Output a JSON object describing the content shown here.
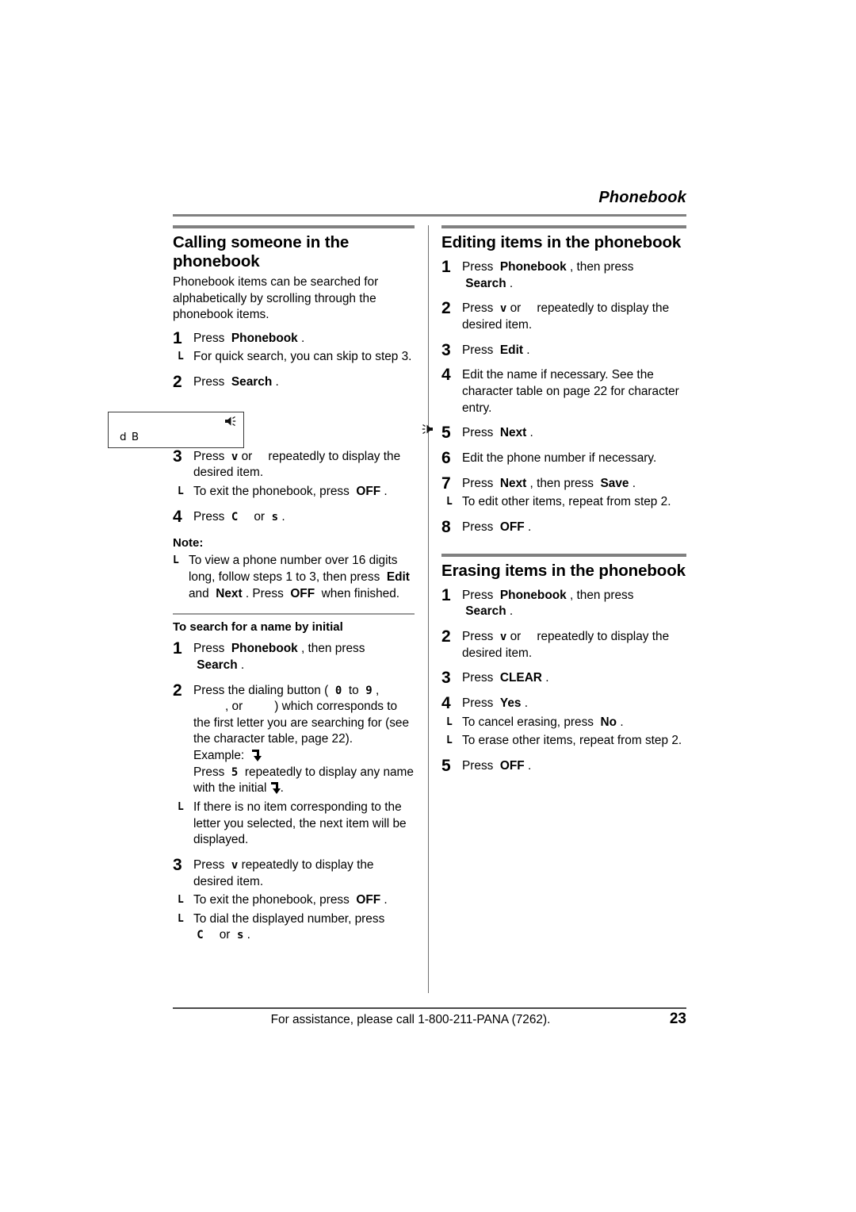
{
  "header": {
    "running_head": "Phonebook"
  },
  "left_column": {
    "section_title": "Calling someone in the phonebook",
    "intro": "Phonebook items can be searched for alphabetically by scrolling through the phonebook items.",
    "steps": [
      {
        "num": "1",
        "text_before": "Press",
        "key1": "Phonebook",
        "text_after": ".",
        "bullets": [
          "For quick search, you can skip to step 3."
        ]
      },
      {
        "num": "2",
        "text_before": "Press",
        "key1": "Search",
        "text_after": ".",
        "bullets": []
      },
      {
        "num": "3",
        "text_before": "Press",
        "glyph1": "v",
        "text_mid": "or",
        "text_after": "repeatedly to display the desired item.",
        "bullets": [
          "To exit the phonebook, press OFF ."
        ]
      },
      {
        "num": "4",
        "text_before": "Press",
        "glyph1": "C",
        "text_mid": "or",
        "glyph2": "s",
        "text_after": ".",
        "bullets": []
      }
    ],
    "note_heading": "Note:",
    "note_bullets": [
      "To view a phone number over 16 digits long, follow steps 1 to 3, then press Edit and Next . Press OFF when finished."
    ],
    "lcd": {
      "text": "d B",
      "icon": "speaker-icon"
    },
    "subsection_title": "To search for a name by initial",
    "sub_steps": [
      {
        "num": "1",
        "text_before": "Press",
        "key1": "Phonebook",
        "text_mid": ", then press",
        "key2": "Search",
        "text_after": ".",
        "bullets": []
      },
      {
        "num": "2",
        "text_before": "Press the dialing button (",
        "key_low": "0",
        "text_to": "to",
        "key_high": "9",
        "text_after": ", , or ) which corresponds to the first letter you are searching for (see the character table, page 22).",
        "example_label": "Example:",
        "example_press": "Press",
        "example_key": "5",
        "example_text": "repeatedly to display any name with the initial",
        "bullets": [
          "If there is no item corresponding to the letter you selected, the next item will be displayed."
        ]
      },
      {
        "num": "3",
        "text_before": "Press",
        "glyph1": "v",
        "text_after": "repeatedly to display the desired item.",
        "bullets": [
          "To exit the phonebook, press OFF .",
          "To dial the displayed number, press C or s ."
        ]
      }
    ]
  },
  "right_column": {
    "section1_title": "Editing items in the phonebook",
    "section1_steps": [
      {
        "num": "1",
        "line1": "Press",
        "key1": "Phonebook",
        "mid": ", then press",
        "key2": "Search",
        "end": "."
      },
      {
        "num": "2",
        "line1": "Press",
        "glyph1": "v",
        "mid": "or",
        "end": "repeatedly to display the desired item."
      },
      {
        "num": "3",
        "line1": "Press",
        "key1": "Edit",
        "end": "."
      },
      {
        "num": "4",
        "line1": "Edit the name if necessary. See the character table on page 22 for character entry."
      },
      {
        "num": "5",
        "line1": "Press",
        "key1": "Next",
        "end": ".",
        "marker": "pointer-icon"
      },
      {
        "num": "6",
        "line1": "Edit the phone number if necessary."
      },
      {
        "num": "7",
        "line1": "Press",
        "key1": "Next",
        "mid": ", then press",
        "key2": "Save",
        "end": ".",
        "bullets": [
          "To edit other items, repeat from step 2."
        ]
      },
      {
        "num": "8",
        "line1": "Press",
        "key1": "OFF",
        "end": "."
      }
    ],
    "section2_title": "Erasing items in the phonebook",
    "section2_steps": [
      {
        "num": "1",
        "line1": "Press",
        "key1": "Phonebook",
        "mid": ", then press",
        "key2": "Search",
        "end": "."
      },
      {
        "num": "2",
        "line1": "Press",
        "glyph1": "v",
        "mid": "or",
        "end": "repeatedly to display the desired item."
      },
      {
        "num": "3",
        "line1": "Press",
        "key1": "CLEAR",
        "end": "."
      },
      {
        "num": "4",
        "line1": "Press",
        "key1": "Yes",
        "end": ".",
        "bullets": [
          "To cancel erasing, press No .",
          "To erase other items, repeat from step 2."
        ]
      },
      {
        "num": "5",
        "line1": "Press",
        "key1": "OFF",
        "end": "."
      }
    ]
  },
  "footer": {
    "assistance_text": "For assistance, please call 1-800-211-PANA (7262).",
    "page_number": "23"
  },
  "labels": {
    "bullet_mark": "L",
    "key_off": "OFF",
    "key_edit": "Edit",
    "key_next": "Next",
    "key_no": "No",
    "key_search": "Search",
    "key_phonebook": "Phonebook",
    "glyph_v": "v",
    "glyph_c": "C",
    "glyph_s": "s"
  }
}
